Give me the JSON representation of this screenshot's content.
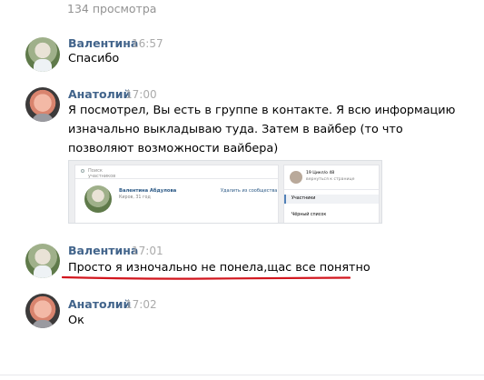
{
  "views": "134 просмотра",
  "messages": [
    {
      "author": "Валентина",
      "time": "16:57",
      "text": "Спасибо"
    },
    {
      "author": "Анатолий",
      "time": "17:00",
      "text": "Я посмотрел, Вы есть в группе в контакте. Я всю информацию изначально выкладываю туда. Затем в вайбер (то что позволяют возможности вайбера)"
    },
    {
      "author": "Валентина",
      "time": "17:01",
      "text": "Просто я изночально не понела,щас все понятно"
    },
    {
      "author": "Анатолий",
      "time": "17:02",
      "text": "Ок"
    }
  ],
  "attachment": {
    "search_placeholder": "Поиск участников",
    "member_name": "Валентина Абдулова",
    "member_city": "Киров, 31 год",
    "remove_link": "Удалить из сообщества",
    "group_line1": "19 Цикл/о 48",
    "group_line2": "вернуться к странице",
    "menu_active": "Участники",
    "menu_blacklist": "Чёрный список"
  },
  "colors": {
    "author": "#42648b",
    "time": "#aaaaaa",
    "underline": "#d2161e"
  }
}
